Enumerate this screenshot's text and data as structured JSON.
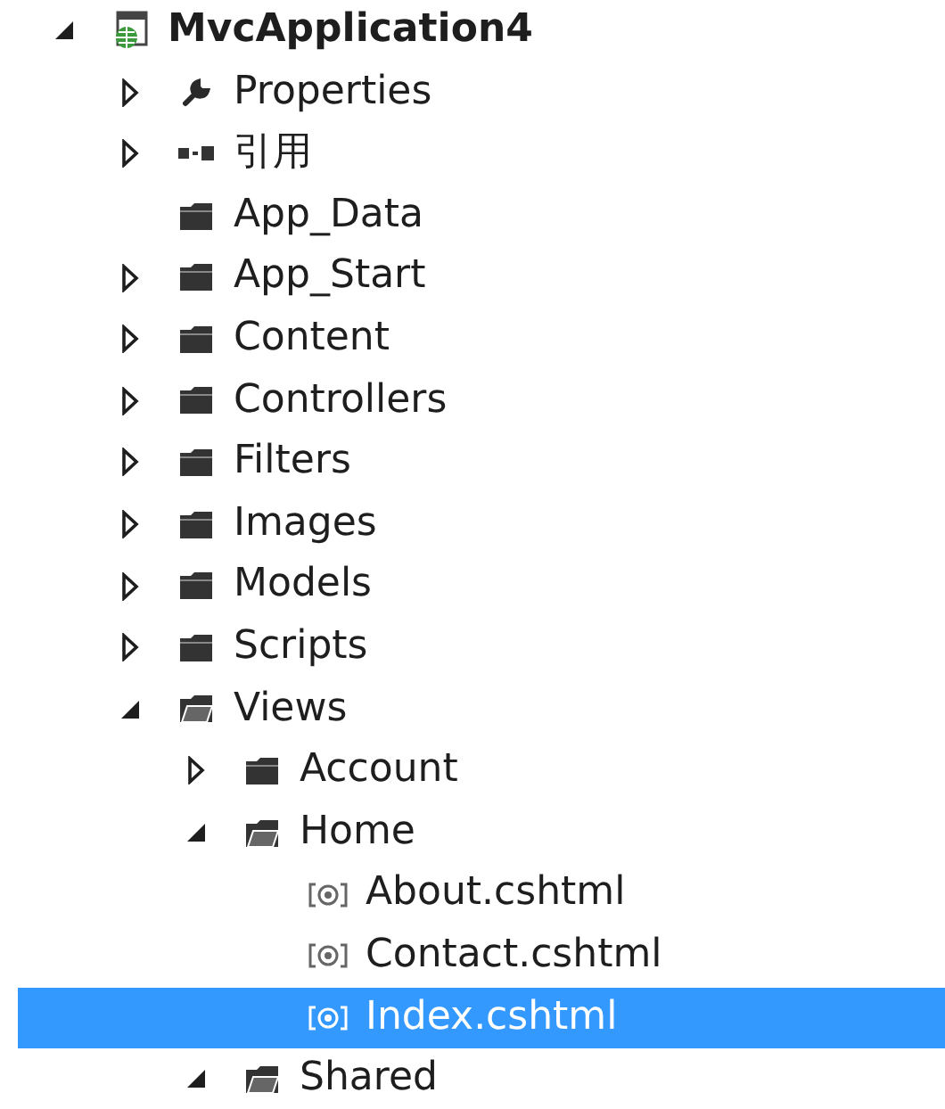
{
  "tree": [
    {
      "label": "MvcApplication4",
      "kind": "project",
      "expanded": true,
      "selected": false,
      "children": [
        {
          "label": "Properties",
          "kind": "properties",
          "expanded": false,
          "selected": false
        },
        {
          "label": "引用",
          "kind": "references",
          "expanded": false,
          "selected": false
        },
        {
          "label": "App_Data",
          "kind": "folder",
          "selected": false
        },
        {
          "label": "App_Start",
          "kind": "folder",
          "expanded": false,
          "selected": false
        },
        {
          "label": "Content",
          "kind": "folder",
          "expanded": false,
          "selected": false
        },
        {
          "label": "Controllers",
          "kind": "folder",
          "expanded": false,
          "selected": false
        },
        {
          "label": "Filters",
          "kind": "folder",
          "expanded": false,
          "selected": false
        },
        {
          "label": "Images",
          "kind": "folder",
          "expanded": false,
          "selected": false
        },
        {
          "label": "Models",
          "kind": "folder",
          "expanded": false,
          "selected": false
        },
        {
          "label": "Scripts",
          "kind": "folder",
          "expanded": false,
          "selected": false
        },
        {
          "label": "Views",
          "kind": "folder",
          "expanded": true,
          "selected": false,
          "children": [
            {
              "label": "Account",
              "kind": "folder",
              "expanded": false,
              "selected": false
            },
            {
              "label": "Home",
              "kind": "folder",
              "expanded": true,
              "selected": false,
              "children": [
                {
                  "label": "About.cshtml",
                  "kind": "file",
                  "selected": false
                },
                {
                  "label": "Contact.cshtml",
                  "kind": "file",
                  "selected": false
                },
                {
                  "label": "Index.cshtml",
                  "kind": "file",
                  "selected": true
                }
              ]
            },
            {
              "label": "Shared",
              "kind": "folder",
              "expanded": true,
              "selected": false
            }
          ]
        }
      ]
    }
  ]
}
